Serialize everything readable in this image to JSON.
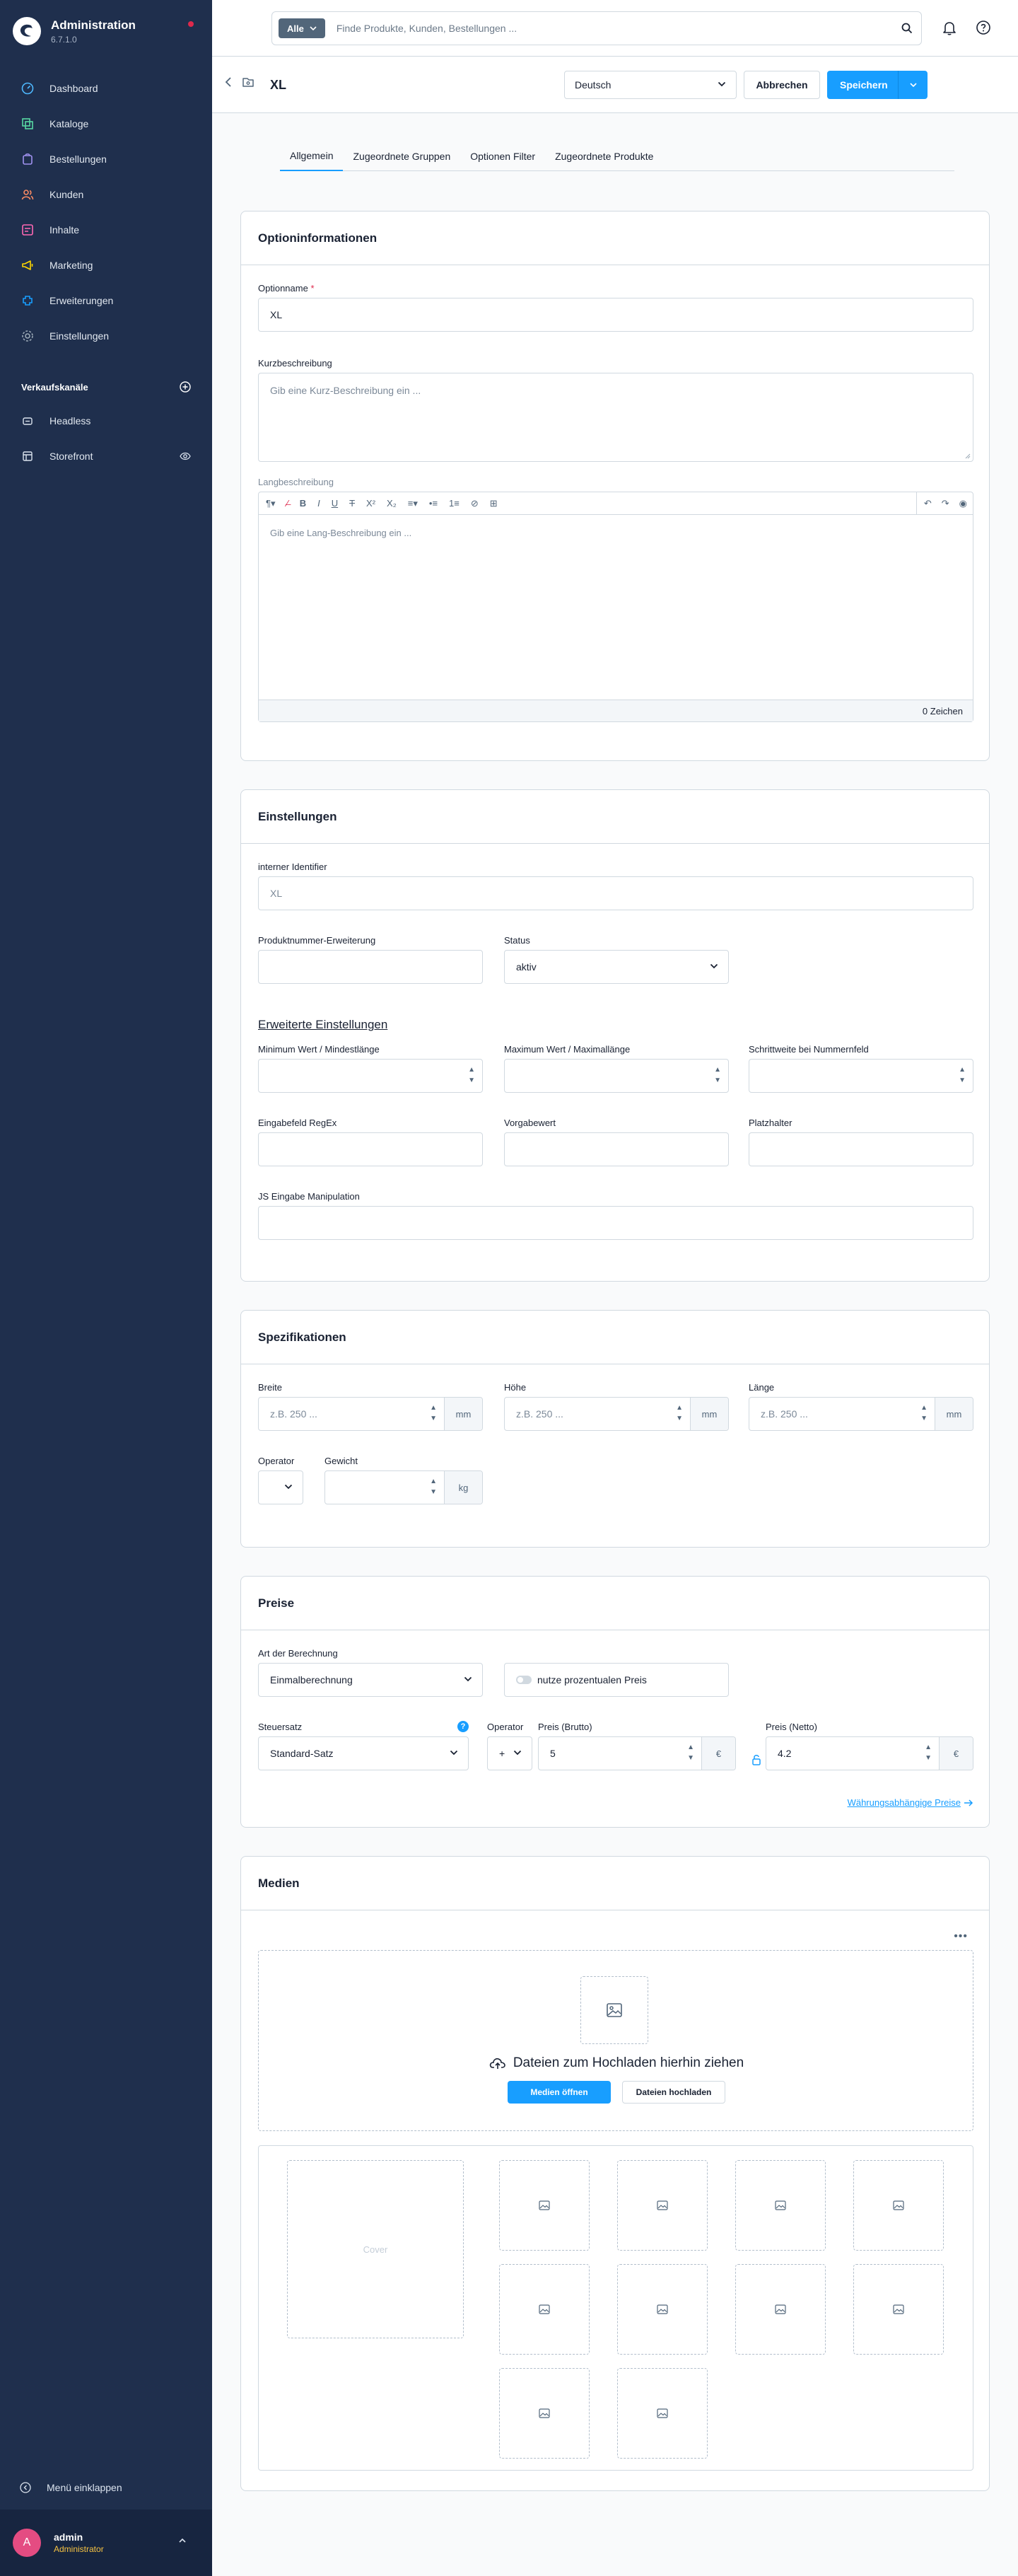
{
  "brand": {
    "title": "Administration",
    "version": "6.7.1.0"
  },
  "nav": [
    {
      "label": "Dashboard",
      "icon": "dashboard-icon",
      "color": "#4eb9ff"
    },
    {
      "label": "Kataloge",
      "icon": "catalog-icon",
      "color": "#57d9a3"
    },
    {
      "label": "Bestellungen",
      "icon": "orders-icon",
      "color": "#a092f0"
    },
    {
      "label": "Kunden",
      "icon": "customers-icon",
      "color": "#f88962"
    },
    {
      "label": "Inhalte",
      "icon": "content-icon",
      "color": "#ff68b4"
    },
    {
      "label": "Marketing",
      "icon": "marketing-icon",
      "color": "#ffd700"
    },
    {
      "label": "Erweiterungen",
      "icon": "extensions-icon",
      "color": "#189eff"
    },
    {
      "label": "Einstellungen",
      "icon": "settings-icon",
      "color": "#9aa8b5"
    }
  ],
  "sales_channels": {
    "heading": "Verkaufskanäle",
    "items": [
      {
        "label": "Headless"
      },
      {
        "label": "Storefront"
      }
    ]
  },
  "sidebar_footer": {
    "collapse_label": "Menü einklappen",
    "user_initial": "A",
    "user_name": "admin",
    "user_role": "Administrator"
  },
  "search": {
    "type_label": "Alle",
    "placeholder": "Finde Produkte, Kunden, Bestellungen ..."
  },
  "actionbar": {
    "title": "XL",
    "language": "Deutsch",
    "cancel_label": "Abbrechen",
    "save_label": "Speichern"
  },
  "tabs": [
    {
      "label": "Allgemein",
      "active": true
    },
    {
      "label": "Zugeordnete Gruppen"
    },
    {
      "label": "Optionen Filter"
    },
    {
      "label": "Zugeordnete Produkte"
    }
  ],
  "option_info": {
    "title": "Optioninformationen",
    "name_label": "Optionname",
    "required_mark": "*",
    "name_value": "XL",
    "short_label": "Kurzbeschreibung",
    "short_placeholder": "Gib eine Kurz-Beschreibung ein ...",
    "long_label": "Langbeschreibung",
    "long_placeholder": "Gib eine Lang-Beschreibung ein ...",
    "char_count": "0 Zeichen"
  },
  "settings": {
    "title": "Einstellungen",
    "identifier_label": "interner Identifier",
    "identifier_placeholder": "XL",
    "productnumber_label": "Produktnummer-Erweiterung",
    "status_label": "Status",
    "status_value": "aktiv",
    "advanced_label": "Erweiterte Einstellungen",
    "min_label": "Minimum Wert / Mindestlänge",
    "max_label": "Maximum Wert / Maximallänge",
    "step_label": "Schrittweite bei Nummernfeld",
    "regex_label": "Eingabefeld RegEx",
    "default_label": "Vorgabewert",
    "placeholder_label": "Platzhalter",
    "js_label": "JS Eingabe Manipulation"
  },
  "specs": {
    "title": "Spezifikationen",
    "width_label": "Breite",
    "height_label": "Höhe",
    "length_label": "Länge",
    "dim_placeholder": "z.B. 250 ...",
    "dim_unit": "mm",
    "operator_label": "Operator",
    "weight_label": "Gewicht",
    "weight_unit": "kg"
  },
  "prices": {
    "title": "Preise",
    "calc_label": "Art der Berechnung",
    "calc_value": "Einmalberechnung",
    "percentage_label": "nutze prozentualen Preis",
    "tax_label": "Steuersatz",
    "tax_value": "Standard-Satz",
    "info_mark": "?",
    "operator_label": "Operator",
    "operator_value": "+",
    "gross_label": "Preis (Brutto)",
    "gross_value": "5",
    "net_label": "Preis (Netto)",
    "net_value": "4.2",
    "currency": "€",
    "currency_link": "Währungsabhängige Preise"
  },
  "media": {
    "title": "Medien",
    "drop_text": "Dateien zum Hochladen hierhin ziehen",
    "open_label": "Medien öffnen",
    "upload_label": "Dateien hochladen",
    "cover_label": "Cover"
  }
}
